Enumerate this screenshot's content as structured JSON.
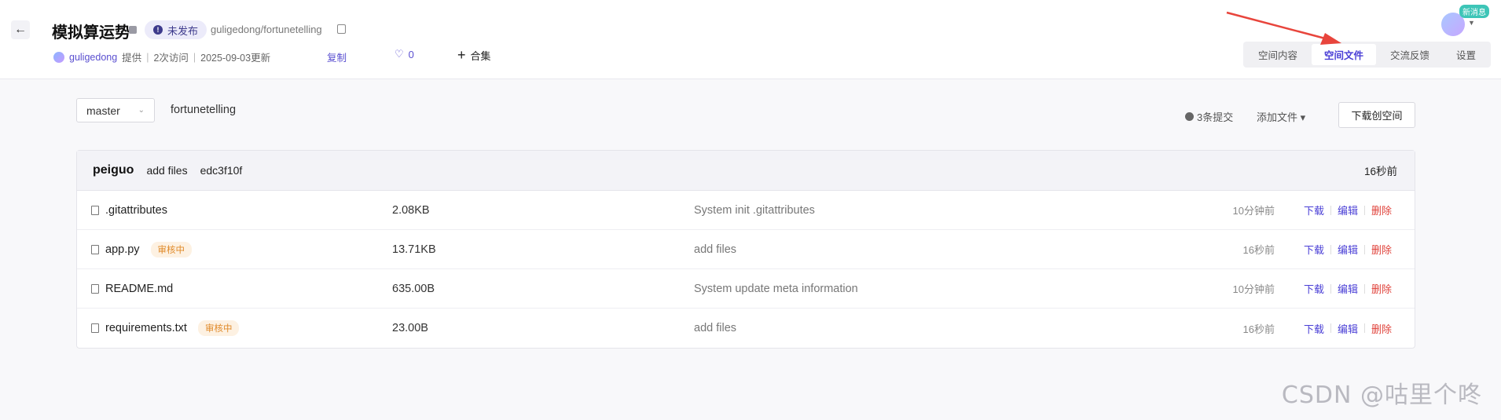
{
  "header": {
    "title": "模拟算运势",
    "status": "未发布",
    "repo_path": "guligedong/fortunetelling",
    "user": "guligedong",
    "provided": "提供",
    "visits": "2次访问",
    "updated": "2025-09-03更新",
    "copy_label": "复制",
    "like_count": "0",
    "collection_label": "合集",
    "new_message": "新消息"
  },
  "tabs": [
    {
      "label": "空间内容"
    },
    {
      "label": "空间文件"
    },
    {
      "label": "交流反馈"
    },
    {
      "label": "设置"
    }
  ],
  "toolbar": {
    "branch": "master",
    "repo_name": "fortunetelling",
    "commits": "3条提交",
    "add_file": "添加文件 ▾",
    "download": "下载创空间"
  },
  "latest_commit": {
    "author": "peiguo",
    "message": "add files",
    "hash": "edc3f10f",
    "time": "16秒前"
  },
  "files": [
    {
      "name": ".gitattributes",
      "badge": "",
      "size": "2.08KB",
      "commit": "System init .gitattributes",
      "time": "10分钟前"
    },
    {
      "name": "app.py",
      "badge": "审核中",
      "size": "13.71KB",
      "commit": "add files",
      "time": "16秒前"
    },
    {
      "name": "README.md",
      "badge": "",
      "size": "635.00B",
      "commit": "System update meta information",
      "time": "10分钟前"
    },
    {
      "name": "requirements.txt",
      "badge": "审核中",
      "size": "23.00B",
      "commit": "add files",
      "time": "16秒前"
    }
  ],
  "actions": {
    "download": "下载",
    "edit": "编辑",
    "delete": "删除"
  },
  "watermark": "CSDN @咕里个咚",
  "colors": {
    "accent": "#4a3fd6",
    "danger": "#e0443d",
    "review": "#e08a2a",
    "annotation_arrow": "#e8453c"
  }
}
